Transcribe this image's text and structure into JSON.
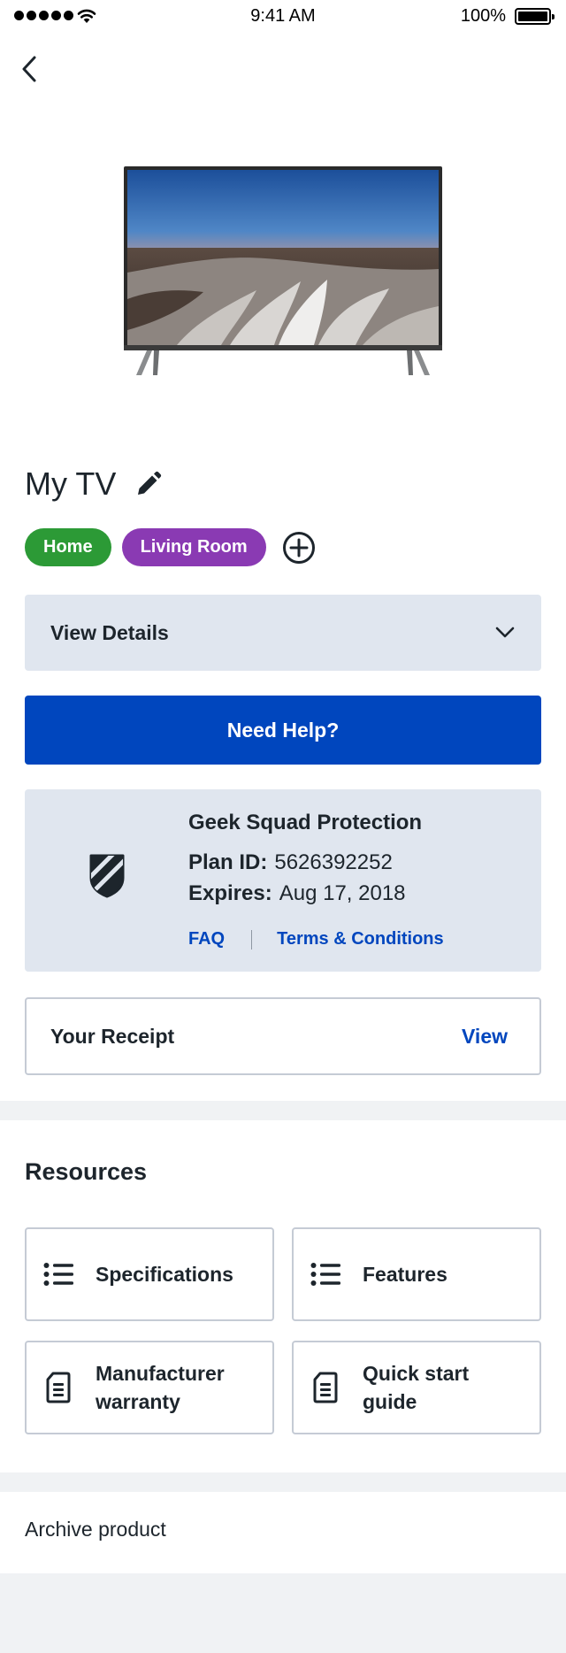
{
  "status_bar": {
    "time": "9:41 AM",
    "battery": "100%"
  },
  "product": {
    "title": "My TV"
  },
  "tags": [
    {
      "label": "Home",
      "color": "#2c9a36"
    },
    {
      "label": "Living Room",
      "color": "#8a3ab3"
    }
  ],
  "details": {
    "label": "View Details"
  },
  "help": {
    "label": "Need Help?"
  },
  "protection": {
    "title": "Geek Squad Protection",
    "plan_id_label": "Plan ID:",
    "plan_id": "5626392252",
    "expires_label": "Expires:",
    "expires": "Aug 17, 2018",
    "faq_label": "FAQ",
    "terms_label": "Terms & Conditions"
  },
  "receipt": {
    "label": "Your Receipt",
    "link": "View"
  },
  "resources": {
    "title": "Resources",
    "items": [
      {
        "label": "Specifications",
        "icon": "list-icon"
      },
      {
        "label": "Features",
        "icon": "list-icon"
      },
      {
        "label": "Manufacturer warranty",
        "icon": "document-icon"
      },
      {
        "label": "Quick start guide",
        "icon": "document-icon"
      }
    ]
  },
  "archive": {
    "label": "Archive product"
  },
  "colors": {
    "primary_blue": "#0046be",
    "card_gray": "#e0e6ef",
    "text": "#1d252c"
  }
}
